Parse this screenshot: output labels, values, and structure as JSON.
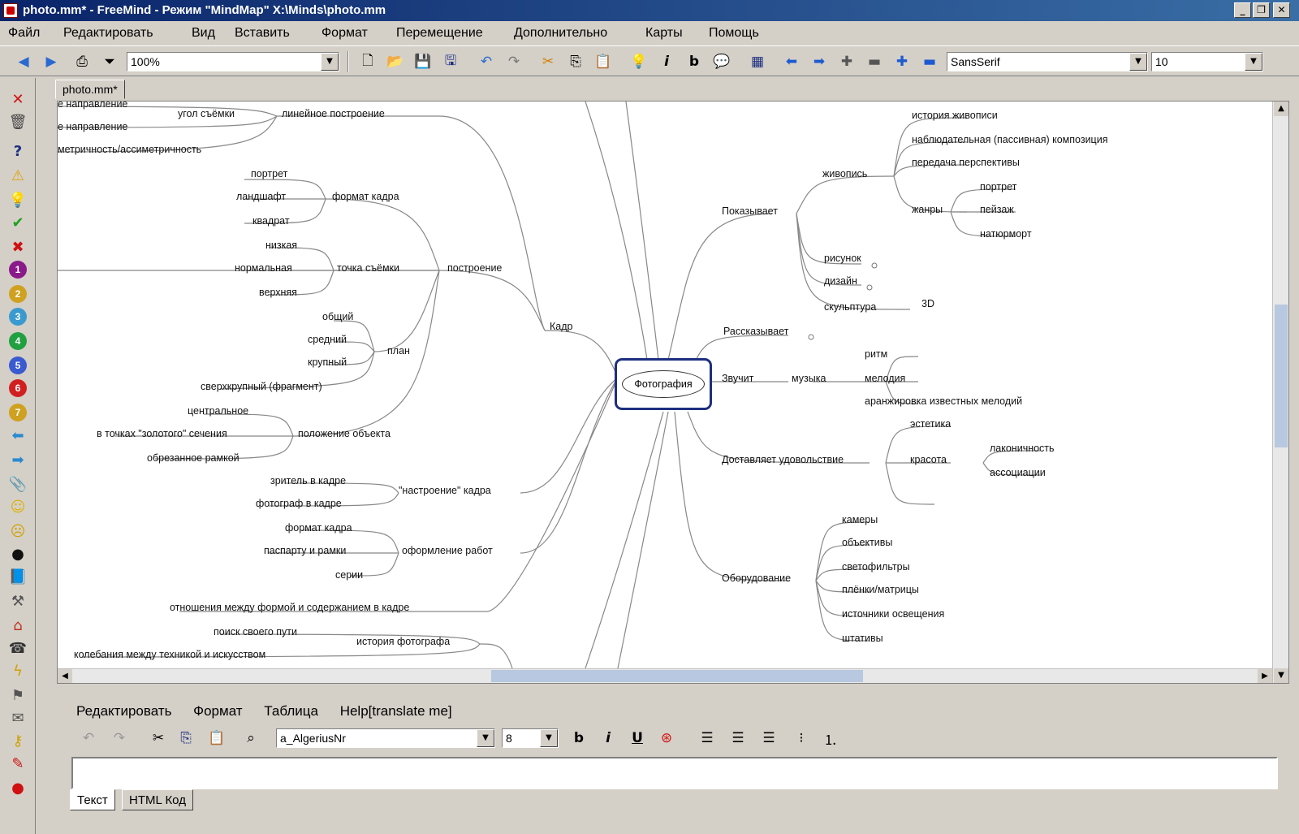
{
  "window": {
    "title": "photo.mm* - FreeMind - Режим \"MindMap\" X:\\Minds\\photo.mm"
  },
  "menu": [
    "Файл",
    "Редактировать",
    "Вид",
    "Вставить",
    "Формат",
    "Перемещение",
    "Дополнительно",
    "Карты",
    "Помощь"
  ],
  "toolbar": {
    "zoom": "100%",
    "font": "SansSerif",
    "size": "10"
  },
  "tab": "photo.mm*",
  "map": {
    "root": "Фотография",
    "right": {
      "shows": "Показывает",
      "painting": "живопись",
      "painting_items": [
        "история живописи",
        "наблюдательная (пассивная) композиция",
        "передача перспективы"
      ],
      "genres": "жанры",
      "genre_items": [
        "портрет",
        "пейзаж",
        "натюрморт"
      ],
      "drawing": "рисунок",
      "design": "дизайн",
      "sculpture": "скульптура",
      "three_d": "3D",
      "tells": "Рассказывает",
      "sounds": "Звучит",
      "music": "музыка",
      "music_items": [
        "ритм",
        "мелодия",
        "аранжировка известных мелодий"
      ],
      "delight": "Доставляет удовольствие",
      "aesthetics": "эстетика",
      "beauty": "красота",
      "beauty_items": [
        "лаконичность",
        "ассоциации"
      ],
      "equipment": "Оборудование",
      "equipment_items": [
        "камеры",
        "объективы",
        "светофильтры",
        "плёнки/матрицы",
        "источники освещения",
        "штативы"
      ]
    },
    "left": {
      "frame": "Кадр",
      "construction": "построение",
      "linear": "линейное построение",
      "angle": "угол съёмки",
      "angle_items": [
        "е направление",
        "е направление",
        "метричность/ассиметричность"
      ],
      "format": "формат кадра",
      "format_items": [
        "портрет",
        "ландшафт",
        "квадрат"
      ],
      "point": "точка съёмки",
      "point_items": [
        "низкая",
        "нормальная",
        "верхняя"
      ],
      "plan": "план",
      "plan_items": [
        "общий",
        "средний",
        "крупный",
        "сверхкрупный (фрагмент)"
      ],
      "position": "положение объекта",
      "position_items": [
        "центральное",
        "в точках \"золотого\" сечения",
        "обрезанное рамкой"
      ],
      "mood": "\"настроение\" кадра",
      "mood_items": [
        "зритель в кадре",
        "фотограф в кадре"
      ],
      "design": "оформление работ",
      "design_items": [
        "формат кадра",
        "паспарту и рамки",
        "серии"
      ],
      "relation": "отношения между формой и содержанием в кадре",
      "history": "история фотографа",
      "history_items": [
        "поиск своего пути",
        "колебания между техникой и искусством"
      ]
    }
  },
  "note": {
    "menu": [
      "Редактировать",
      "Формат",
      "Таблица",
      "Help[translate me]"
    ],
    "font": "a_AlgeriusNr",
    "size": "8",
    "tabs": [
      "Текст",
      "HTML Код"
    ]
  },
  "colors": {
    "title_bg": "#0a246a",
    "root_border": "#1d2f80"
  }
}
